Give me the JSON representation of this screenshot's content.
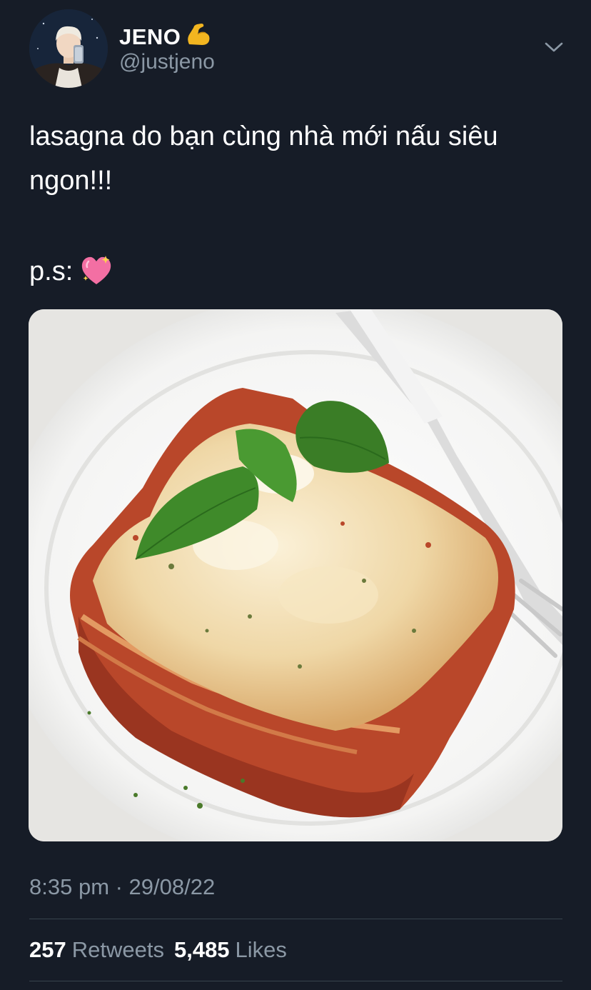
{
  "author": {
    "display_name": "JENO",
    "name_emoji": "flexed-biceps-emoji",
    "handle": "@justjeno"
  },
  "tweet": {
    "text": "lasagna do bạn cùng nhà mới nấu siêu ngon!!!",
    "ps_text": "p.s:",
    "ps_emoji": "sparkling-heart-emoji",
    "timestamp": "8:35 pm · 29/08/22"
  },
  "stats": {
    "retweets_count": "257",
    "retweets_label": "Retweets",
    "likes_count": "5,485",
    "likes_label": "Likes"
  },
  "colors": {
    "background": "#161c27",
    "secondary_text": "#8b98a5",
    "divider": "#38444d"
  }
}
